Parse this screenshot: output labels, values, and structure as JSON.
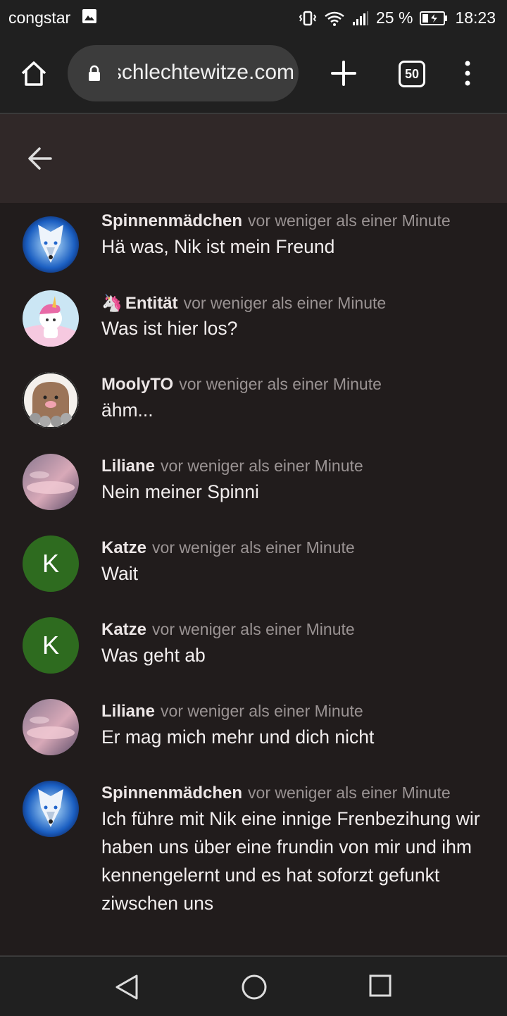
{
  "status_bar": {
    "carrier": "congstar",
    "battery": "25 %",
    "time": "18:23"
  },
  "browser": {
    "url": "schlechtewitze.com",
    "tab_count": "50"
  },
  "colors": {
    "background": "#211c1c",
    "header": "#302828",
    "avatar_green": "#2e6b1f"
  },
  "messages": [
    {
      "author": "Spinnenmädchen",
      "time": "vor weniger als einer Minute",
      "text": "Hä was, Nik ist mein Freund",
      "avatar": "wolf-avatar"
    },
    {
      "author": "Entität",
      "author_prefix": "🦄",
      "time": "vor weniger als einer Minute",
      "text": "Was ist hier los?",
      "avatar": "unicorn-avatar"
    },
    {
      "author": "MoolyTO",
      "time": "vor weniger als einer Minute",
      "text": "ähm...",
      "avatar": "mole-avatar"
    },
    {
      "author": "Liliane",
      "time": "vor weniger als einer Minute",
      "text": "Nein meiner Spinni",
      "avatar": "pink-clouds-avatar"
    },
    {
      "author": "Katze",
      "time": "vor weniger als einer Minute",
      "text": "Wait",
      "avatar_letter": "K"
    },
    {
      "author": "Katze",
      "time": "vor weniger als einer Minute",
      "text": "Was geht ab",
      "avatar_letter": "K"
    },
    {
      "author": "Liliane",
      "time": "vor weniger als einer Minute",
      "text": "Er mag mich mehr und dich nicht",
      "avatar": "pink-clouds-avatar"
    },
    {
      "author": "Spinnenmädchen",
      "time": "vor weniger als einer Minute",
      "text": "Ich führe mit Nik eine innige Frenbezihung wir haben uns über eine frundin von mir und ihm kennengelernt und es hat soforzt gefunkt ziwschen uns",
      "avatar": "wolf-avatar"
    }
  ]
}
